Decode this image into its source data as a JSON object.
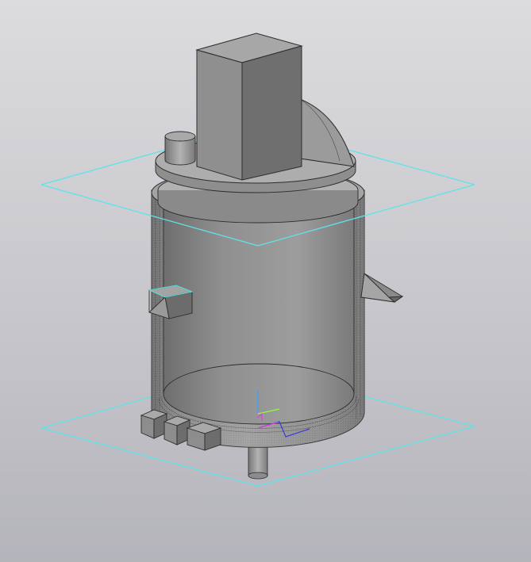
{
  "viewport": {
    "background_top": "#dcdcdf",
    "background_bottom": "#b4b4bb"
  },
  "scene": {
    "plane_color": "#5fe3e8",
    "body_fill": "#8f8f8f",
    "edge_color": "#2c2c2c",
    "axis_colors": {
      "x": "#3a3adf",
      "y": "#8aff3c",
      "z": "#3aa0ff",
      "origin": "#e040e0"
    }
  }
}
